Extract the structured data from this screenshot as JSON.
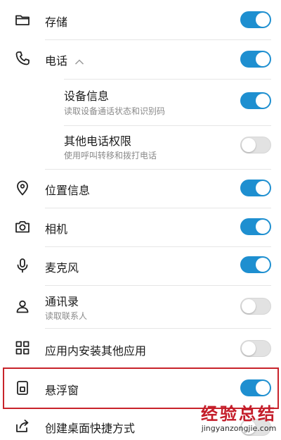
{
  "colors": {
    "toggle_on": "#1e8fd0",
    "toggle_off": "#e2e2e2",
    "highlight": "#c8232b",
    "watermark": "#c41d2a"
  },
  "permissions": [
    {
      "id": "storage",
      "icon": "folder-icon",
      "title": "存储",
      "subtitle": "",
      "enabled": true
    },
    {
      "id": "phone",
      "icon": "phone-icon",
      "title": "电话",
      "subtitle": "",
      "enabled": true,
      "expanded": true
    },
    {
      "id": "device-info",
      "icon": "",
      "title": "设备信息",
      "subtitle": "读取设备通话状态和识别码",
      "enabled": true,
      "child": true
    },
    {
      "id": "other-phone",
      "icon": "",
      "title": "其他电话权限",
      "subtitle": "使用呼叫转移和拨打电话",
      "enabled": false,
      "child": true
    },
    {
      "id": "location",
      "icon": "location-pin-icon",
      "title": "位置信息",
      "subtitle": "",
      "enabled": true
    },
    {
      "id": "camera",
      "icon": "camera-icon",
      "title": "相机",
      "subtitle": "",
      "enabled": true
    },
    {
      "id": "microphone",
      "icon": "microphone-icon",
      "title": "麦克风",
      "subtitle": "",
      "enabled": true
    },
    {
      "id": "contacts",
      "icon": "person-icon",
      "title": "通讯录",
      "subtitle": "读取联系人",
      "enabled": false
    },
    {
      "id": "install-apps",
      "icon": "app-grid-icon",
      "title": "应用内安装其他应用",
      "subtitle": "",
      "enabled": false
    },
    {
      "id": "floating-window",
      "icon": "floating-window-icon",
      "title": "悬浮窗",
      "subtitle": "",
      "enabled": true,
      "highlighted": true
    },
    {
      "id": "shortcut",
      "icon": "share-arrow-icon",
      "title": "创建桌面快捷方式",
      "subtitle": "",
      "enabled": false
    }
  ],
  "watermark": {
    "main": "经验总结",
    "url": "jingyanzongjie.com"
  }
}
